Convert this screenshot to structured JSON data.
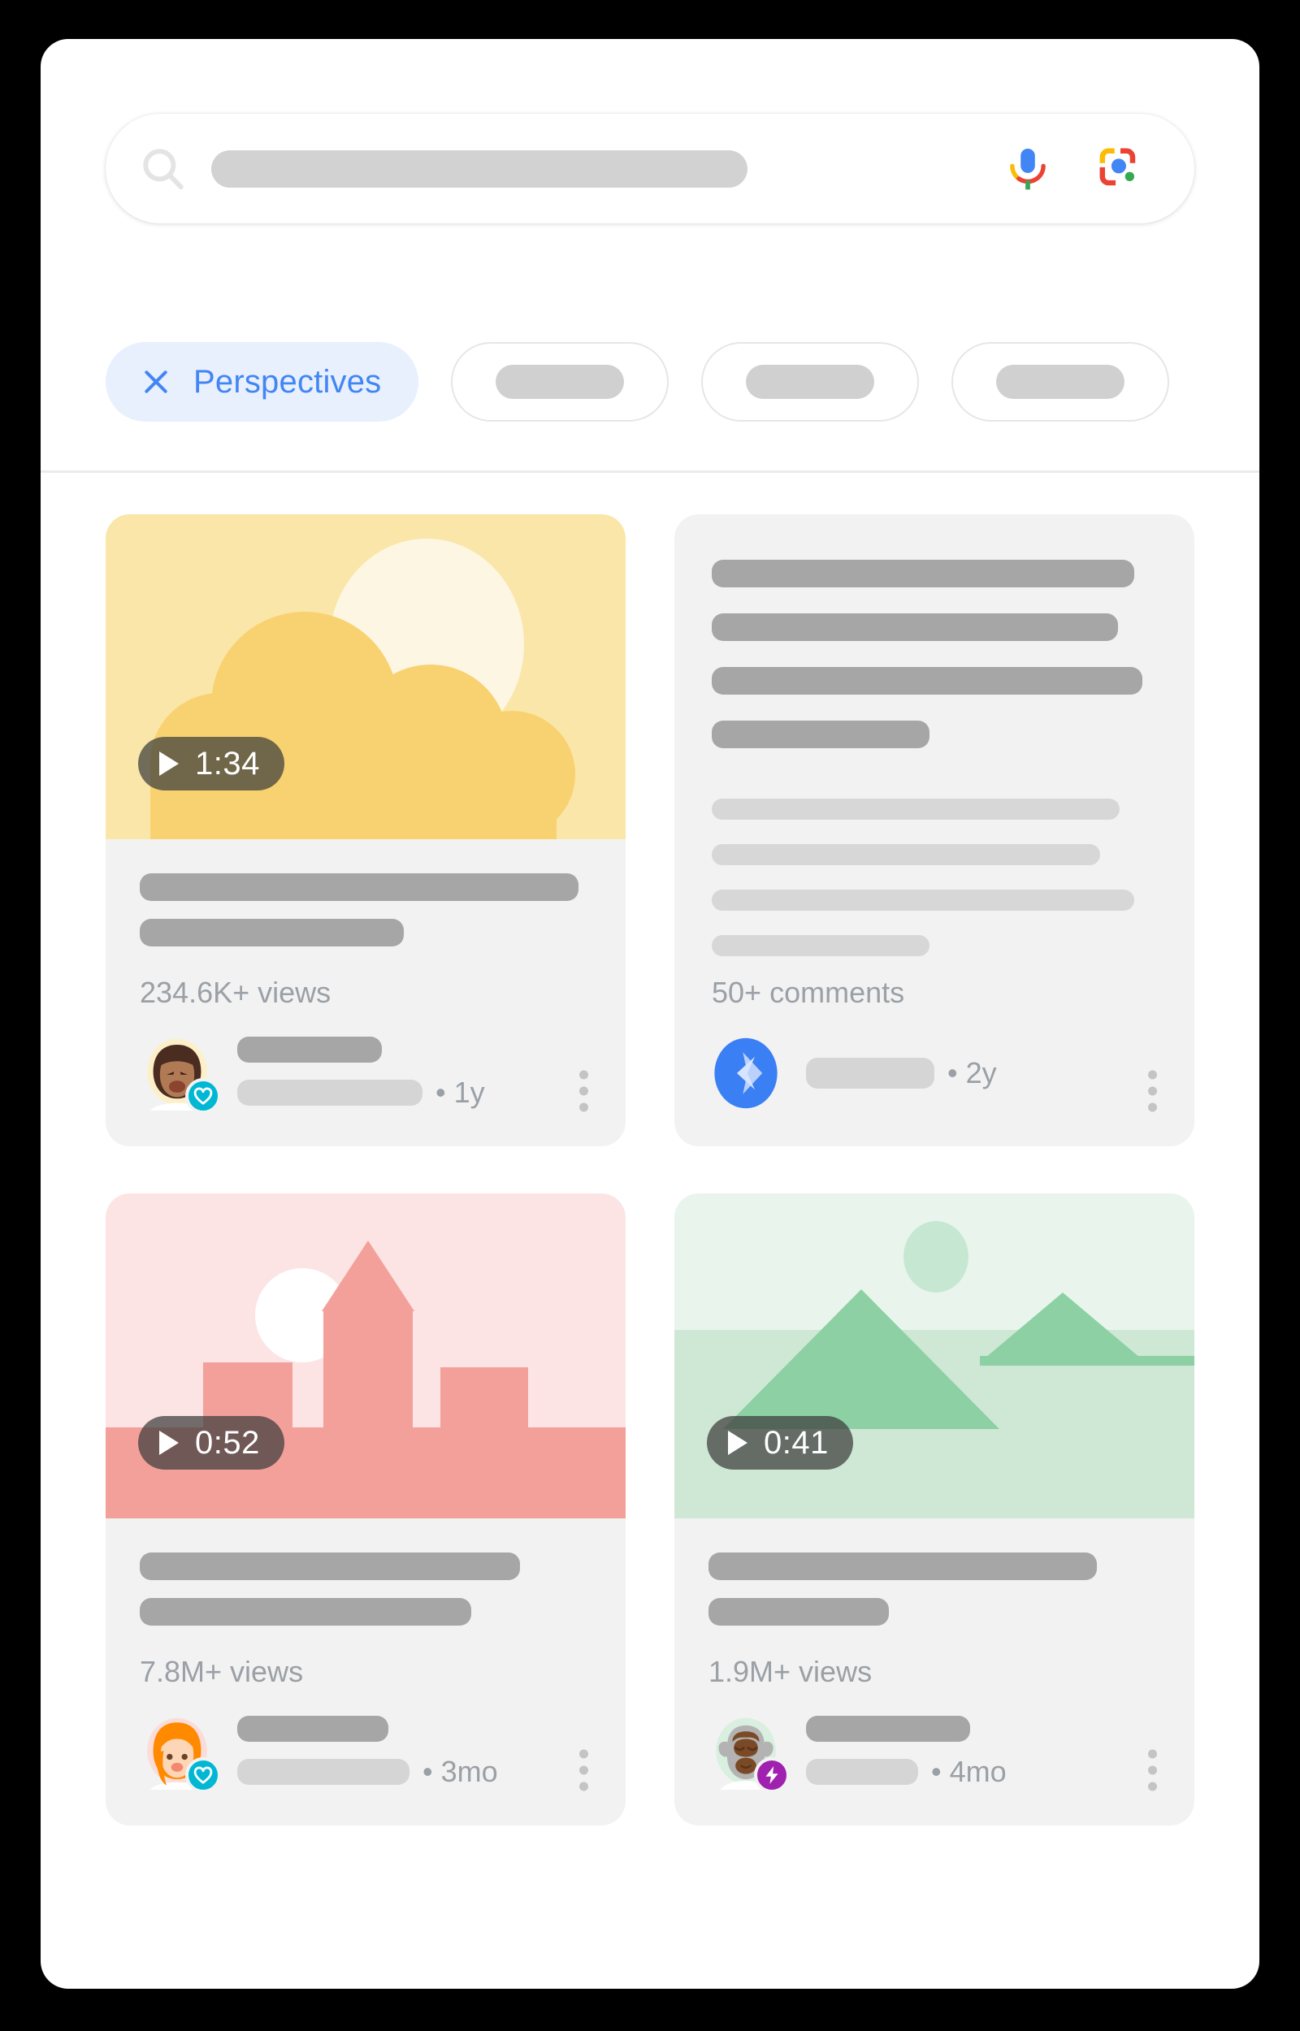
{
  "search": {
    "placeholder": "",
    "icons": {
      "search": "search-icon",
      "mic": "microphone-icon",
      "lens": "google-lens-icon"
    }
  },
  "filters": {
    "active_chip": {
      "label": "Perspectives",
      "icon": "close-x-icon",
      "accent": "#4285f4",
      "background": "#e8f0fe"
    },
    "placeholder_chips": 3
  },
  "cards": [
    {
      "id": "card-video-sunset",
      "type": "video",
      "thumbnail": "sun-and-clouds-illustration",
      "thumb_colors": {
        "sky": "#fae6a8",
        "sun": "#fdf6e3",
        "cloud": "#f7d271"
      },
      "duration": "1:34",
      "meta": "234.6K+ views",
      "avatar": "woman-dark-hair-avatar",
      "badge": "heart-badge",
      "badge_color": "#00b8d4",
      "age": "• 1y",
      "menu": "more-options-icon"
    },
    {
      "id": "card-text-discussion",
      "type": "text",
      "thumbnail": null,
      "duration": null,
      "meta": "50+ comments",
      "avatar": "blue-spark-avatar",
      "badge": null,
      "badge_color": "#4285f4",
      "age": "• 2y",
      "menu": "more-options-icon"
    },
    {
      "id": "card-video-city",
      "type": "video",
      "thumbnail": "pink-cityscape-illustration",
      "thumb_colors": {
        "sky": "#fce4e4",
        "ground": "#f3a09a",
        "building": "#f3a09a",
        "moon": "#ffffff"
      },
      "duration": "0:52",
      "meta": "7.8M+ views",
      "avatar": "woman-orange-hair-avatar",
      "badge": "heart-badge",
      "badge_color": "#00b8d4",
      "age": "• 3mo",
      "menu": "more-options-icon"
    },
    {
      "id": "card-video-mountains",
      "type": "video",
      "thumbnail": "green-mountains-illustration",
      "thumb_colors": {
        "sky": "#e9f5ec",
        "ground": "#cfe8d5",
        "mountain": "#8cd0a3",
        "sun": "#c6e8d2"
      },
      "duration": "0:41",
      "meta": "1.9M+ views",
      "avatar": "bull-avatar",
      "badge": "lightning-badge",
      "badge_color": "#a020b0",
      "age": "• 4mo",
      "menu": "more-options-icon"
    }
  ]
}
